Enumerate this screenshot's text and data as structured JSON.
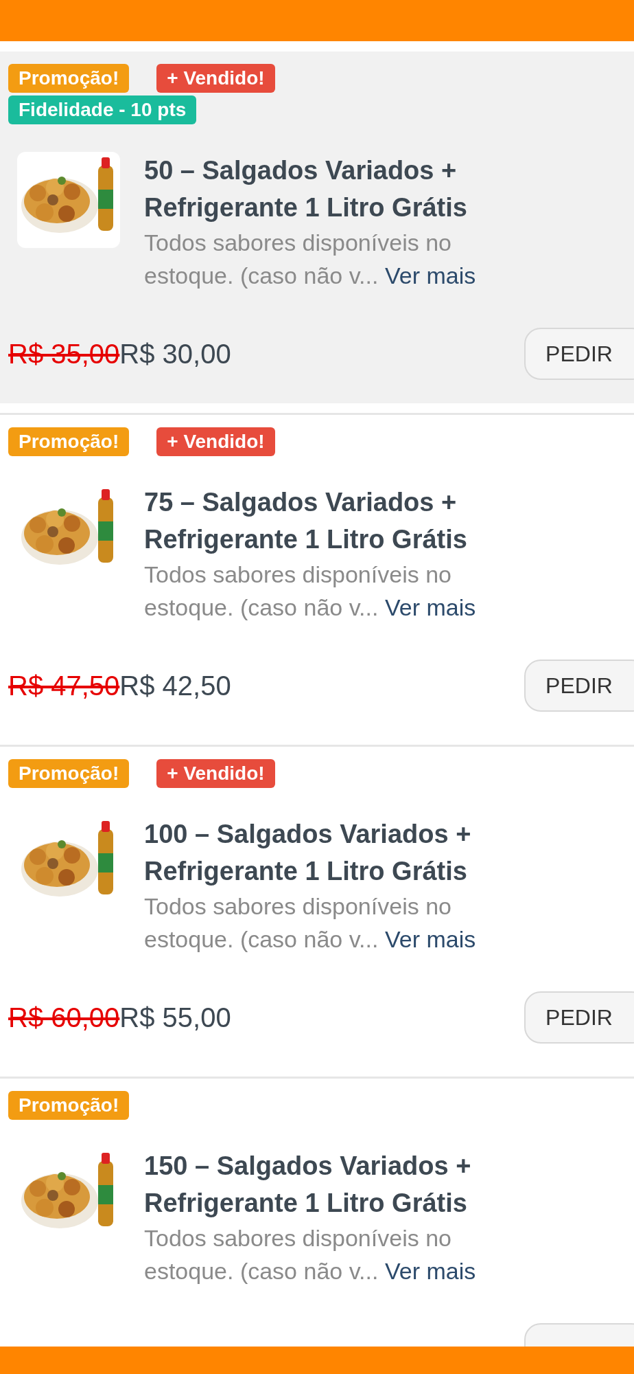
{
  "products": [
    {
      "highlighted": true,
      "badges": [
        {
          "text": "Promoção!",
          "kind": "promo"
        },
        {
          "text": "+ Vendido!",
          "kind": "bestseller"
        },
        {
          "text": "Fidelidade - 10 pts",
          "kind": "loyalty"
        }
      ],
      "image": {
        "kind": "picture"
      },
      "title": "50 – Salgados Variados + Refrigerante 1 Litro Grátis",
      "description": "Todos sabores disponíveis no estoque. (caso não v...",
      "more_link": "Ver mais",
      "old_price": "R$ 35,00",
      "price": "R$ 30,00",
      "button": "PEDIR"
    },
    {
      "highlighted": false,
      "badges": [
        {
          "text": "Promoção!",
          "kind": "promo"
        },
        {
          "text": "+ Vendido!",
          "kind": "bestseller"
        }
      ],
      "image": {
        "kind": "picture"
      },
      "title": "75 – Salgados Variados + Refrigerante 1 Litro Grátis",
      "description": "Todos sabores disponíveis no estoque. (caso não v...",
      "more_link": "Ver mais",
      "old_price": "R$ 47,50",
      "price": "R$ 42,50",
      "button": "PEDIR"
    },
    {
      "highlighted": false,
      "badges": [
        {
          "text": "Promoção!",
          "kind": "promo"
        },
        {
          "text": "+ Vendido!",
          "kind": "bestseller"
        }
      ],
      "image": {
        "kind": "picture"
      },
      "title": "100 – Salgados Variados + Refrigerante 1 Litro Grátis",
      "description": "Todos sabores disponíveis no estoque. (caso não v...",
      "more_link": "Ver mais",
      "old_price": "R$ 60,00",
      "price": "R$ 55,00",
      "button": "PEDIR"
    },
    {
      "highlighted": false,
      "badges": [
        {
          "text": "Promoção!",
          "kind": "promo"
        }
      ],
      "image": {
        "kind": "picture"
      },
      "title": "150 – Salgados Variados + Refrigerante 1 Litro Grátis",
      "description": "Todos sabores disponíveis no estoque. (caso não v...",
      "more_link": "Ver mais"
    }
  ]
}
